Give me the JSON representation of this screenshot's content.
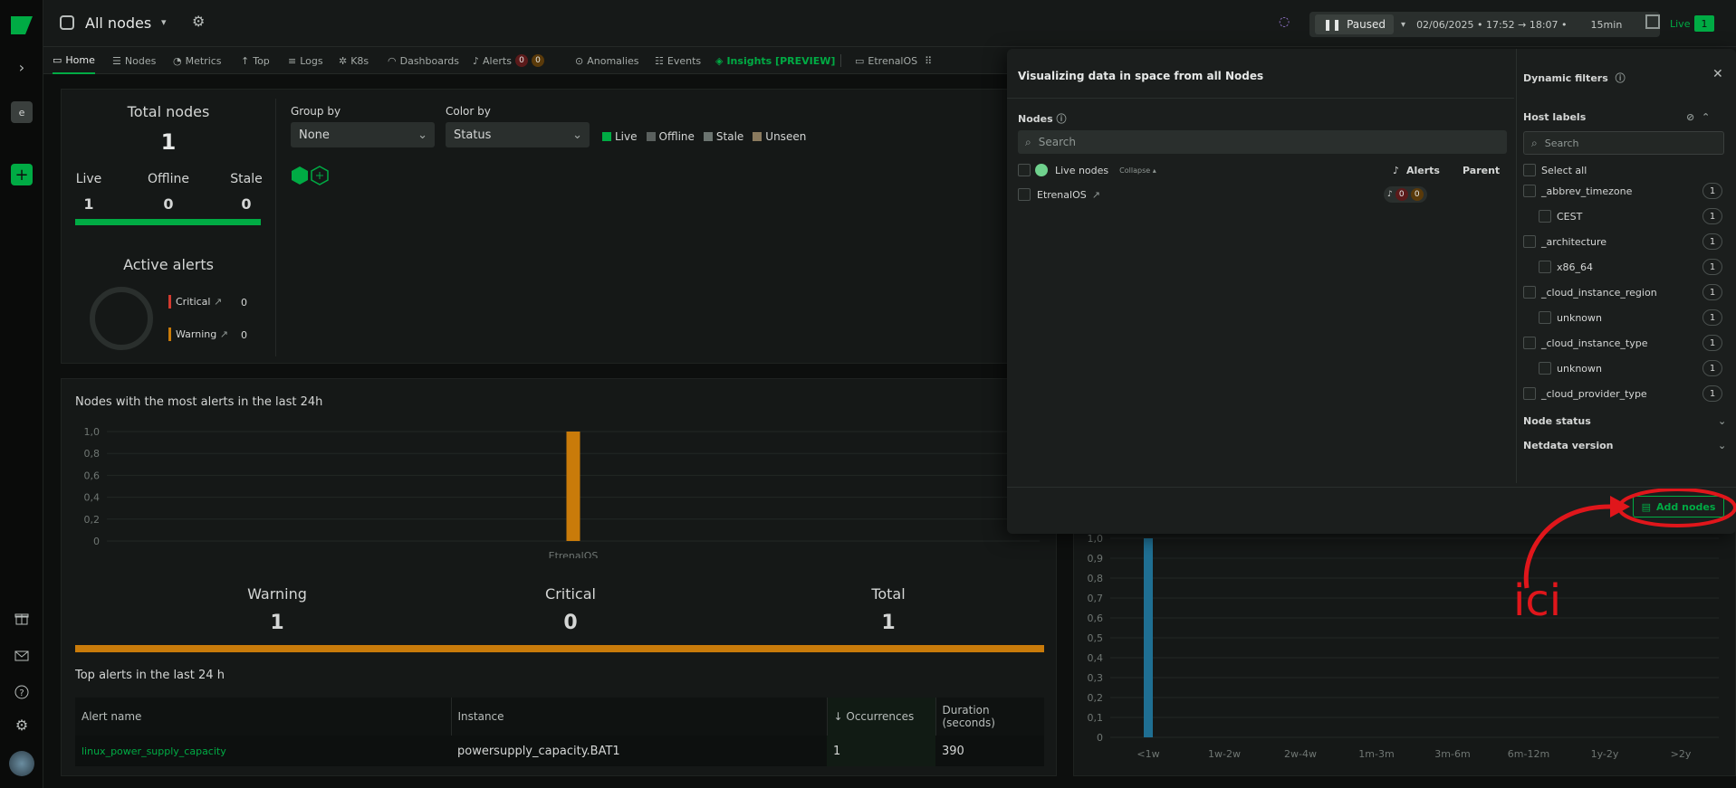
{
  "header": {
    "space_name": "All nodes",
    "status": "Paused",
    "time_range": "02/06/2025 • 17:52 → 18:07 •",
    "duration": "15min",
    "live_label": "Live",
    "live_count": "1"
  },
  "rail": {
    "space_letter": "e"
  },
  "tabs": [
    {
      "label": "Home"
    },
    {
      "label": "Nodes"
    },
    {
      "label": "Metrics"
    },
    {
      "label": "Top"
    },
    {
      "label": "Logs"
    },
    {
      "label": "K8s"
    },
    {
      "label": "Dashboards"
    },
    {
      "label": "Alerts"
    },
    {
      "label": "Anomalies"
    },
    {
      "label": "Events"
    },
    {
      "label": "Insights [PREVIEW]"
    },
    {
      "label": "EtrenalOS"
    }
  ],
  "alerts_badges": {
    "critical": "0",
    "warning": "0"
  },
  "summary": {
    "total_nodes_label": "Total nodes",
    "total_nodes": "1",
    "live_label": "Live",
    "live": "1",
    "offline_label": "Offline",
    "offline": "0",
    "stale_label": "Stale",
    "stale": "0",
    "active_alerts_label": "Active alerts",
    "critical_label": "Critical",
    "critical": "0",
    "warning_label": "Warning",
    "warning": "0"
  },
  "map_controls": {
    "group_by_label": "Group by",
    "group_by_value": "None",
    "color_by_label": "Color by",
    "color_by_value": "Status",
    "legend": [
      {
        "label": "Live",
        "color": "#00ab44"
      },
      {
        "label": "Offline",
        "color": "#5a605e"
      },
      {
        "label": "Stale",
        "color": "#6b7470"
      },
      {
        "label": "Unseen",
        "color": "#8a7a5e"
      }
    ]
  },
  "alerts_chart": {
    "title": "Nodes with the most alerts in the last 24h",
    "warning_label": "Warning",
    "warning": "1",
    "critical_label": "Critical",
    "critical": "0",
    "total_label": "Total",
    "total": "1"
  },
  "chart_data": [
    {
      "type": "bar",
      "title": "Nodes with the most alerts in the last 24h",
      "categories": [
        "EtrenalOS"
      ],
      "values": [
        1
      ],
      "y_ticks": [
        "1,0",
        "0,8",
        "0,6",
        "0,4",
        "0,2",
        "0"
      ],
      "ylim": [
        0,
        1
      ],
      "color": "#c97b0a"
    },
    {
      "type": "bar",
      "categories": [
        "<1w",
        "1w-2w",
        "2w-4w",
        "1m-3m",
        "3m-6m",
        "6m-12m",
        "1y-2y",
        ">2y"
      ],
      "values": [
        1,
        0,
        0,
        0,
        0,
        0,
        0,
        0
      ],
      "y_ticks": [
        "1,0",
        "0,9",
        "0,8",
        "0,7",
        "0,6",
        "0,5",
        "0,4",
        "0,3",
        "0,2",
        "0,1",
        "0"
      ],
      "ylim": [
        0,
        1
      ],
      "color": "#1f6f93"
    }
  ],
  "top_alerts": {
    "title": "Top alerts in the last 24 h",
    "columns": [
      "Alert name",
      "Instance",
      "↓ Occurrences",
      "Duration (seconds)"
    ],
    "rows": [
      {
        "name": "linux_power_supply_capacity",
        "instance": "powersupply_capacity.BAT1",
        "occurrences": "1",
        "duration": "390"
      }
    ]
  },
  "overlay": {
    "title": "Visualizing data in space from all Nodes",
    "nodes_label": "Nodes",
    "search_placeholder": "Search",
    "live_nodes_label": "Live nodes",
    "collapse_label": "Collapse",
    "alerts_col": "Alerts",
    "parent_col": "Parent",
    "node_name": "EtrenalOS",
    "node_alerts_critical": "0",
    "node_alerts_warning": "0",
    "dynamic_filters": "Dynamic filters",
    "host_labels": "Host labels",
    "filter_search_placeholder": "Search",
    "select_all": "Select all",
    "labels": [
      {
        "name": "_abbrev_timezone",
        "count": "1",
        "indent": false
      },
      {
        "name": "CEST",
        "count": "1",
        "indent": true
      },
      {
        "name": "_architecture",
        "count": "1",
        "indent": false
      },
      {
        "name": "x86_64",
        "count": "1",
        "indent": true
      },
      {
        "name": "_cloud_instance_region",
        "count": "1",
        "indent": false
      },
      {
        "name": "unknown",
        "count": "1",
        "indent": true
      },
      {
        "name": "_cloud_instance_type",
        "count": "1",
        "indent": false
      },
      {
        "name": "unknown",
        "count": "1",
        "indent": true
      },
      {
        "name": "_cloud_provider_type",
        "count": "1",
        "indent": false
      }
    ],
    "node_status": "Node status",
    "netdata_version": "Netdata version",
    "add_nodes": "Add nodes"
  },
  "annotation": {
    "text": "ici",
    "color": "#e0161b"
  }
}
